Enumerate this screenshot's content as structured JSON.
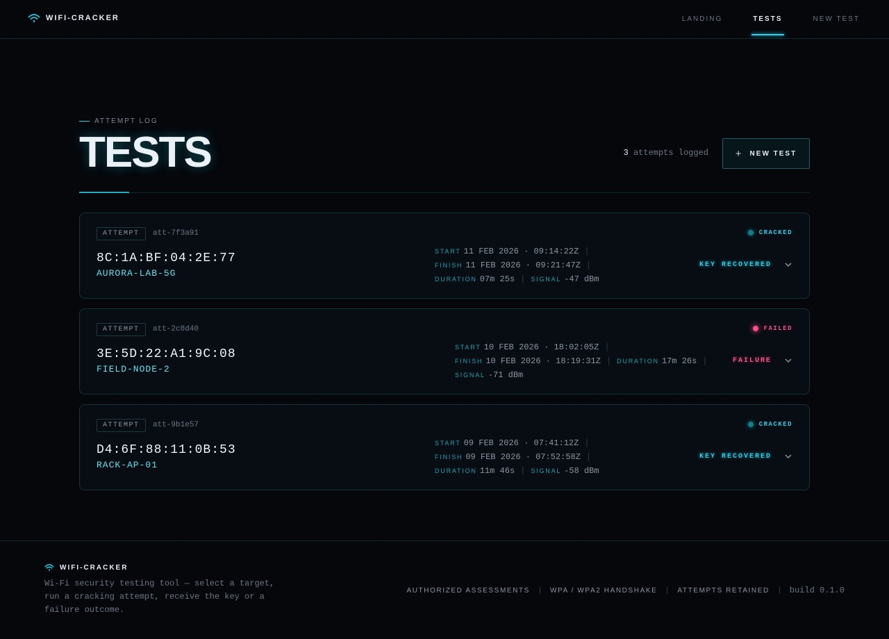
{
  "brand": {
    "name": "WIFI-CRACKER"
  },
  "nav": [
    {
      "label": "LANDING",
      "active": false
    },
    {
      "label": "TESTS",
      "active": true
    },
    {
      "label": "NEW TEST",
      "active": false
    }
  ],
  "page": {
    "eyebrow": "ATTEMPT LOG",
    "title": "TESTS",
    "count": "3",
    "count_suffix": "attempts logged",
    "new_button": "NEW TEST"
  },
  "labels": {
    "tag": "ATTEMPT",
    "start": "START",
    "finish": "FINISH",
    "duration": "DURATION",
    "signal": "SIGNAL"
  },
  "attempts": [
    {
      "id": "att-7f3a91",
      "mac": "8C:1A:BF:04:2E:77",
      "ssid": "AURORA-LAB-5G",
      "start": "11 FEB 2026 · 09:14:22Z",
      "finish": "11 FEB 2026 · 09:21:47Z",
      "duration": "07m 25s",
      "signal": "-47 dBm",
      "status": "CRACKED",
      "outcome": "KEY RECOVERED"
    },
    {
      "id": "att-2c8d40",
      "mac": "3E:5D:22:A1:9C:08",
      "ssid": "FIELD-NODE-2",
      "start": "10 FEB 2026 · 18:02:05Z",
      "finish": "10 FEB 2026 · 18:19:31Z",
      "duration": "17m 26s",
      "signal": "-71 dBm",
      "status": "FAILED",
      "outcome": "FAILURE"
    },
    {
      "id": "att-9b1e57",
      "mac": "D4:6F:88:11:0B:53",
      "ssid": "RACK-AP-01",
      "start": "09 FEB 2026 · 07:41:12Z",
      "finish": "09 FEB 2026 · 07:52:58Z",
      "duration": "11m 46s",
      "signal": "-58 dBm",
      "status": "CRACKED",
      "outcome": "KEY RECOVERED"
    }
  ],
  "footer": {
    "brand": "WIFI-CRACKER",
    "description": "Wi-Fi security testing tool — select a target, run a cracking attempt, receive the key or a failure outcome.",
    "links": [
      "AUTHORIZED ASSESSMENTS",
      "WPA / WPA2 HANDSHAKE",
      "ATTEMPTS RETAINED"
    ],
    "build": "build 0.1.0"
  },
  "colors": {
    "accent": "#22d3ee",
    "success": "#0e7f8c",
    "failure": "#ff4f8b",
    "background": "#05070b"
  }
}
